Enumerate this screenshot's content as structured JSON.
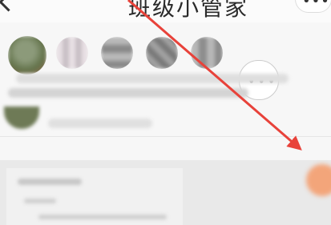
{
  "header": {
    "title": "班级小管家",
    "more_label": "•••"
  },
  "avatars": [
    {
      "name": "avatar-self"
    },
    {
      "name": "avatar-member-1"
    },
    {
      "name": "avatar-member-2"
    },
    {
      "name": "avatar-member-3"
    },
    {
      "name": "avatar-member-4"
    }
  ],
  "avatar_more_label": "•••",
  "annotation": {
    "color": "#e8423a"
  },
  "colors": {
    "accent_orange": "#f3a57a"
  }
}
